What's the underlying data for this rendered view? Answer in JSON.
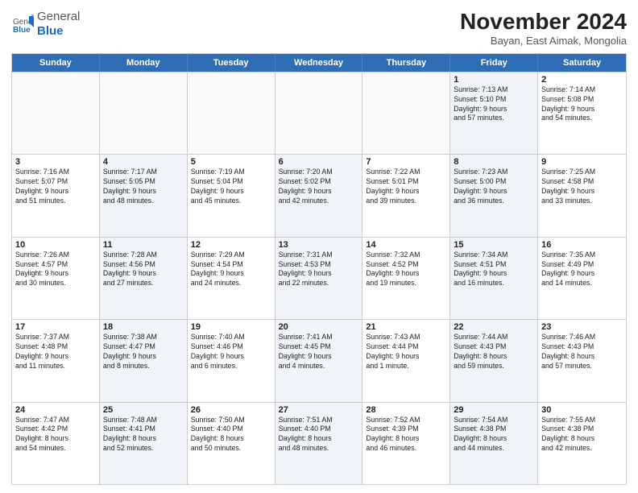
{
  "logo": {
    "general": "General",
    "blue": "Blue"
  },
  "title": "November 2024",
  "subtitle": "Bayan, East Aimak, Mongolia",
  "days_of_week": [
    "Sunday",
    "Monday",
    "Tuesday",
    "Wednesday",
    "Thursday",
    "Friday",
    "Saturday"
  ],
  "weeks": [
    [
      {
        "day": "",
        "info": "",
        "empty": true
      },
      {
        "day": "",
        "info": "",
        "empty": true
      },
      {
        "day": "",
        "info": "",
        "empty": true
      },
      {
        "day": "",
        "info": "",
        "empty": true
      },
      {
        "day": "",
        "info": "",
        "empty": true
      },
      {
        "day": "1",
        "info": "Sunrise: 7:13 AM\nSunset: 5:10 PM\nDaylight: 9 hours\nand 57 minutes.",
        "shaded": true
      },
      {
        "day": "2",
        "info": "Sunrise: 7:14 AM\nSunset: 5:08 PM\nDaylight: 9 hours\nand 54 minutes.",
        "shaded": false
      }
    ],
    [
      {
        "day": "3",
        "info": "Sunrise: 7:16 AM\nSunset: 5:07 PM\nDaylight: 9 hours\nand 51 minutes.",
        "shaded": false
      },
      {
        "day": "4",
        "info": "Sunrise: 7:17 AM\nSunset: 5:05 PM\nDaylight: 9 hours\nand 48 minutes.",
        "shaded": true
      },
      {
        "day": "5",
        "info": "Sunrise: 7:19 AM\nSunset: 5:04 PM\nDaylight: 9 hours\nand 45 minutes.",
        "shaded": false
      },
      {
        "day": "6",
        "info": "Sunrise: 7:20 AM\nSunset: 5:02 PM\nDaylight: 9 hours\nand 42 minutes.",
        "shaded": true
      },
      {
        "day": "7",
        "info": "Sunrise: 7:22 AM\nSunset: 5:01 PM\nDaylight: 9 hours\nand 39 minutes.",
        "shaded": false
      },
      {
        "day": "8",
        "info": "Sunrise: 7:23 AM\nSunset: 5:00 PM\nDaylight: 9 hours\nand 36 minutes.",
        "shaded": true
      },
      {
        "day": "9",
        "info": "Sunrise: 7:25 AM\nSunset: 4:58 PM\nDaylight: 9 hours\nand 33 minutes.",
        "shaded": false
      }
    ],
    [
      {
        "day": "10",
        "info": "Sunrise: 7:26 AM\nSunset: 4:57 PM\nDaylight: 9 hours\nand 30 minutes.",
        "shaded": false
      },
      {
        "day": "11",
        "info": "Sunrise: 7:28 AM\nSunset: 4:56 PM\nDaylight: 9 hours\nand 27 minutes.",
        "shaded": true
      },
      {
        "day": "12",
        "info": "Sunrise: 7:29 AM\nSunset: 4:54 PM\nDaylight: 9 hours\nand 24 minutes.",
        "shaded": false
      },
      {
        "day": "13",
        "info": "Sunrise: 7:31 AM\nSunset: 4:53 PM\nDaylight: 9 hours\nand 22 minutes.",
        "shaded": true
      },
      {
        "day": "14",
        "info": "Sunrise: 7:32 AM\nSunset: 4:52 PM\nDaylight: 9 hours\nand 19 minutes.",
        "shaded": false
      },
      {
        "day": "15",
        "info": "Sunrise: 7:34 AM\nSunset: 4:51 PM\nDaylight: 9 hours\nand 16 minutes.",
        "shaded": true
      },
      {
        "day": "16",
        "info": "Sunrise: 7:35 AM\nSunset: 4:49 PM\nDaylight: 9 hours\nand 14 minutes.",
        "shaded": false
      }
    ],
    [
      {
        "day": "17",
        "info": "Sunrise: 7:37 AM\nSunset: 4:48 PM\nDaylight: 9 hours\nand 11 minutes.",
        "shaded": false
      },
      {
        "day": "18",
        "info": "Sunrise: 7:38 AM\nSunset: 4:47 PM\nDaylight: 9 hours\nand 8 minutes.",
        "shaded": true
      },
      {
        "day": "19",
        "info": "Sunrise: 7:40 AM\nSunset: 4:46 PM\nDaylight: 9 hours\nand 6 minutes.",
        "shaded": false
      },
      {
        "day": "20",
        "info": "Sunrise: 7:41 AM\nSunset: 4:45 PM\nDaylight: 9 hours\nand 4 minutes.",
        "shaded": true
      },
      {
        "day": "21",
        "info": "Sunrise: 7:43 AM\nSunset: 4:44 PM\nDaylight: 9 hours\nand 1 minute.",
        "shaded": false
      },
      {
        "day": "22",
        "info": "Sunrise: 7:44 AM\nSunset: 4:43 PM\nDaylight: 8 hours\nand 59 minutes.",
        "shaded": true
      },
      {
        "day": "23",
        "info": "Sunrise: 7:46 AM\nSunset: 4:43 PM\nDaylight: 8 hours\nand 57 minutes.",
        "shaded": false
      }
    ],
    [
      {
        "day": "24",
        "info": "Sunrise: 7:47 AM\nSunset: 4:42 PM\nDaylight: 8 hours\nand 54 minutes.",
        "shaded": false
      },
      {
        "day": "25",
        "info": "Sunrise: 7:48 AM\nSunset: 4:41 PM\nDaylight: 8 hours\nand 52 minutes.",
        "shaded": true
      },
      {
        "day": "26",
        "info": "Sunrise: 7:50 AM\nSunset: 4:40 PM\nDaylight: 8 hours\nand 50 minutes.",
        "shaded": false
      },
      {
        "day": "27",
        "info": "Sunrise: 7:51 AM\nSunset: 4:40 PM\nDaylight: 8 hours\nand 48 minutes.",
        "shaded": true
      },
      {
        "day": "28",
        "info": "Sunrise: 7:52 AM\nSunset: 4:39 PM\nDaylight: 8 hours\nand 46 minutes.",
        "shaded": false
      },
      {
        "day": "29",
        "info": "Sunrise: 7:54 AM\nSunset: 4:38 PM\nDaylight: 8 hours\nand 44 minutes.",
        "shaded": true
      },
      {
        "day": "30",
        "info": "Sunrise: 7:55 AM\nSunset: 4:38 PM\nDaylight: 8 hours\nand 42 minutes.",
        "shaded": false
      }
    ]
  ]
}
